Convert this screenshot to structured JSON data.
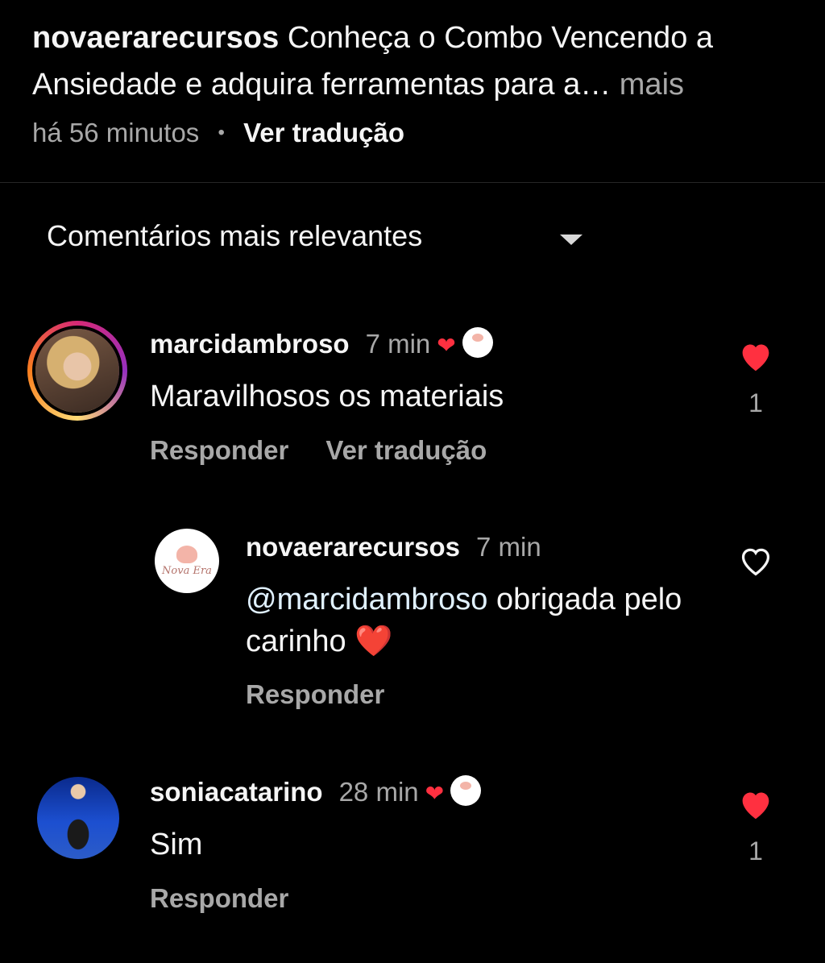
{
  "post": {
    "username": "novaerarecursos",
    "caption": "Conheça o Combo Vencendo a Ansiedade e adquira ferramentas para a…",
    "more_label": "mais",
    "time": "há 56 minutos",
    "translate_label": "Ver tradução"
  },
  "sort": {
    "label": "Comentários mais relevantes"
  },
  "comments": [
    {
      "username": "marcidambroso",
      "time": "7 min",
      "text": "Maravilhosos os materiais",
      "reply_label": "Responder",
      "translate_label": "Ver tradução",
      "likes": "1",
      "liked": true
    },
    {
      "username": "novaerarecursos",
      "time": "7 min",
      "mention": "@marcidambroso",
      "text": " obrigada pelo carinho ❤️",
      "reply_label": "Responder",
      "liked": false
    },
    {
      "username": "soniacatarino",
      "time": "28 min",
      "text": "Sim",
      "reply_label": "Responder",
      "likes": "1",
      "liked": true
    }
  ],
  "colors": {
    "like_red": "#ff3040",
    "muted_text": "#a8a8a8",
    "background": "#000000"
  },
  "icons": {
    "author_heart": "heart-icon",
    "like": "heart-outline-icon",
    "sort": "caret-down-icon"
  }
}
